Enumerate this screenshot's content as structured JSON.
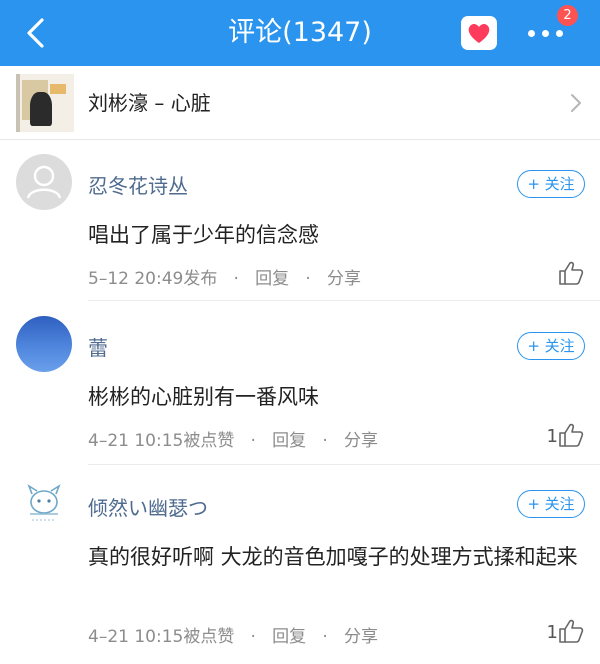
{
  "header": {
    "title": "评论(1347)",
    "notification_count": "2",
    "accent_color": "#2a94ee"
  },
  "song": {
    "title": "刘彬濠 – 心脏"
  },
  "comments": [
    {
      "username": "忍冬花诗丛",
      "follow_label": "+ 关注",
      "content": "唱出了属于少年的信念感",
      "time": "5–12 20:49发布",
      "reply_label": "回复",
      "share_label": "分享",
      "likes": ""
    },
    {
      "username": "蕾",
      "follow_label": "+ 关注",
      "content": "彬彬的心脏别有一番风味",
      "time": "4–21 10:15被点赞",
      "reply_label": "回复",
      "share_label": "分享",
      "likes": "1"
    },
    {
      "username": "倾然い幽瑟つ",
      "follow_label": "+ 关注",
      "content": "真的很好听啊 大龙的音色加嘎子的处理方式揉和起来",
      "time": "4–21 10:15被点赞",
      "reply_label": "回复",
      "share_label": "分享",
      "likes": "1"
    }
  ]
}
